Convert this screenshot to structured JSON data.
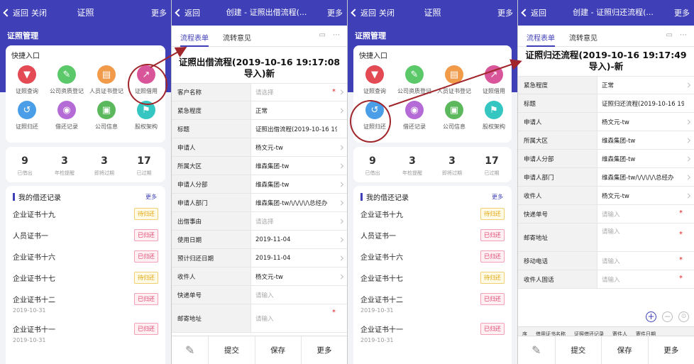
{
  "home": {
    "back_label": "返回",
    "close_label": "关闭",
    "title": "证照",
    "more_label": "更多",
    "section_title": "证照管理",
    "quick_title": "快捷入口",
    "quick_items": [
      {
        "label": "证照查询",
        "icon": "filter-icon",
        "color": "#e34a54"
      },
      {
        "label": "公司资质登记",
        "icon": "pencil-icon",
        "color": "#5bc86a"
      },
      {
        "label": "人员证书登记",
        "icon": "id-card-icon",
        "color": "#f09a4a"
      },
      {
        "label": "证照借用",
        "icon": "share-out-icon",
        "color": "#d9559a"
      },
      {
        "label": "证照归还",
        "icon": "return-icon",
        "color": "#4a9ee8"
      },
      {
        "label": "借还记录",
        "icon": "camera-icon",
        "color": "#b46bd6"
      },
      {
        "label": "公司信息",
        "icon": "briefcase-icon",
        "color": "#5cb85c"
      },
      {
        "label": "股权架构",
        "icon": "flag-icon",
        "color": "#35c6c2"
      }
    ],
    "stats": [
      {
        "value": "9",
        "label": "已借出"
      },
      {
        "value": "3",
        "label": "年检提醒"
      },
      {
        "value": "3",
        "label": "即将过期"
      },
      {
        "value": "17",
        "label": "已过期"
      }
    ],
    "records_title": "我的借还记录",
    "records_more": "更多",
    "records": [
      {
        "name": "企业证书十九",
        "status": "待归还",
        "state": "pending",
        "date": ""
      },
      {
        "name": "人员证书一",
        "status": "已归还",
        "state": "done",
        "date": ""
      },
      {
        "name": "企业证书十六",
        "status": "已归还",
        "state": "done",
        "date": ""
      },
      {
        "name": "企业证书十七",
        "status": "待归还",
        "state": "pending",
        "date": ""
      },
      {
        "name": "企业证书十二",
        "status": "已归还",
        "state": "done",
        "date": "2019-10-31"
      },
      {
        "name": "企业证书十一",
        "status": "已归还",
        "state": "done",
        "date": "2019-10-31"
      }
    ]
  },
  "borrow": {
    "back_label": "返回",
    "title": "创建 - 证照出借流程(...",
    "more_label": "更多",
    "tab_form": "流程表单",
    "tab_opinion": "流转意见",
    "form_title": "证照出借流程(2019-10-16 19:17:08导入)新",
    "fields": [
      {
        "label": "客户名称",
        "value": "请选择",
        "placeholder": true,
        "required": true,
        "chevron": true
      },
      {
        "label": "紧急程度",
        "value": "正常",
        "placeholder": false,
        "required": false,
        "chevron": true
      },
      {
        "label": "标题",
        "value": "证照出借流程(2019-10-16 19:",
        "placeholder": false,
        "required": false,
        "chevron": false
      },
      {
        "label": "申请人",
        "value": "杨文元-tw",
        "placeholder": false,
        "required": false,
        "chevron": true
      },
      {
        "label": "所属大区",
        "value": "维森集团-tw",
        "placeholder": false,
        "required": false,
        "chevron": true
      },
      {
        "label": "申请人分部",
        "value": "维森集团-tw",
        "placeholder": false,
        "required": false,
        "chevron": true
      },
      {
        "label": "申请人部门",
        "value": "维森集团-tw/\\/\\/\\/\\/\\总经办",
        "placeholder": false,
        "required": false,
        "chevron": true
      },
      {
        "label": "出借事由",
        "value": "请选择",
        "placeholder": true,
        "required": false,
        "chevron": true
      },
      {
        "label": "使用日期",
        "value": "2019-11-04",
        "placeholder": false,
        "required": false,
        "chevron": true
      },
      {
        "label": "预计归还日期",
        "value": "2019-11-04",
        "placeholder": false,
        "required": false,
        "chevron": true
      },
      {
        "label": "收件人",
        "value": "杨文元-tw",
        "placeholder": false,
        "required": false,
        "chevron": true
      },
      {
        "label": "快递单号",
        "value": "请输入",
        "placeholder": true,
        "required": false,
        "chevron": false
      },
      {
        "label": "邮寄地址",
        "value": "请输入",
        "placeholder": true,
        "required": true,
        "chevron": false
      }
    ],
    "actions": [
      "提交",
      "保存",
      "更多"
    ]
  },
  "home2": {
    "back_label": "返回",
    "close_label": "关闭",
    "title": "证照",
    "more_label": "更多",
    "section_title": "证照管理",
    "quick_title": "快捷入口",
    "records_title": "我的借还记录",
    "records_more": "更多"
  },
  "return_flow": {
    "back_label": "返回",
    "title": "创建 - 证照归还流程(...",
    "more_label": "更多",
    "tab_form": "流程表单",
    "tab_opinion": "流转意见",
    "form_title": "证照归还流程(2019-10-16 19:17:49导入)-新",
    "fields": [
      {
        "label": "紧急程度",
        "value": "正常",
        "placeholder": false,
        "required": false,
        "chevron": true,
        "h": 26
      },
      {
        "label": "标题",
        "value": "证照归还流程(2019-10-16 19",
        "placeholder": false,
        "required": false,
        "chevron": false,
        "h": 26
      },
      {
        "label": "申请人",
        "value": "杨文元-tw",
        "placeholder": false,
        "required": false,
        "chevron": true,
        "h": 26
      },
      {
        "label": "所属大区",
        "value": "维森集团-tw",
        "placeholder": false,
        "required": false,
        "chevron": true,
        "h": 26
      },
      {
        "label": "申请人分部",
        "value": "维森集团-tw",
        "placeholder": false,
        "required": false,
        "chevron": true,
        "h": 26
      },
      {
        "label": "申请人部门",
        "value": "维森集团-tw/\\/\\/\\/\\/\\总经办",
        "placeholder": false,
        "required": false,
        "chevron": true,
        "h": 26
      },
      {
        "label": "收件人",
        "value": "杨文元-tw",
        "placeholder": false,
        "required": false,
        "chevron": true,
        "h": 26
      },
      {
        "label": "快递单号",
        "value": "请输入",
        "placeholder": true,
        "required": true,
        "chevron": false,
        "h": 26
      },
      {
        "label": "邮寄地址",
        "value": "请输入",
        "placeholder": true,
        "required": true,
        "chevron": false,
        "h": 40
      },
      {
        "label": "移动电话",
        "value": "请输入",
        "placeholder": true,
        "required": true,
        "chevron": false,
        "h": 26
      },
      {
        "label": "收件人固话",
        "value": "请输入",
        "placeholder": true,
        "required": true,
        "chevron": false,
        "h": 26
      }
    ],
    "table_headers": [
      "序",
      "借用证书名称",
      "证照借还记录",
      "寄件人",
      "寄件日期"
    ],
    "actions": [
      "提交",
      "保存",
      "更多"
    ]
  },
  "colors": {
    "brand": "#3f3fb8",
    "highlight": "#a0262c",
    "required": "#e02020"
  }
}
